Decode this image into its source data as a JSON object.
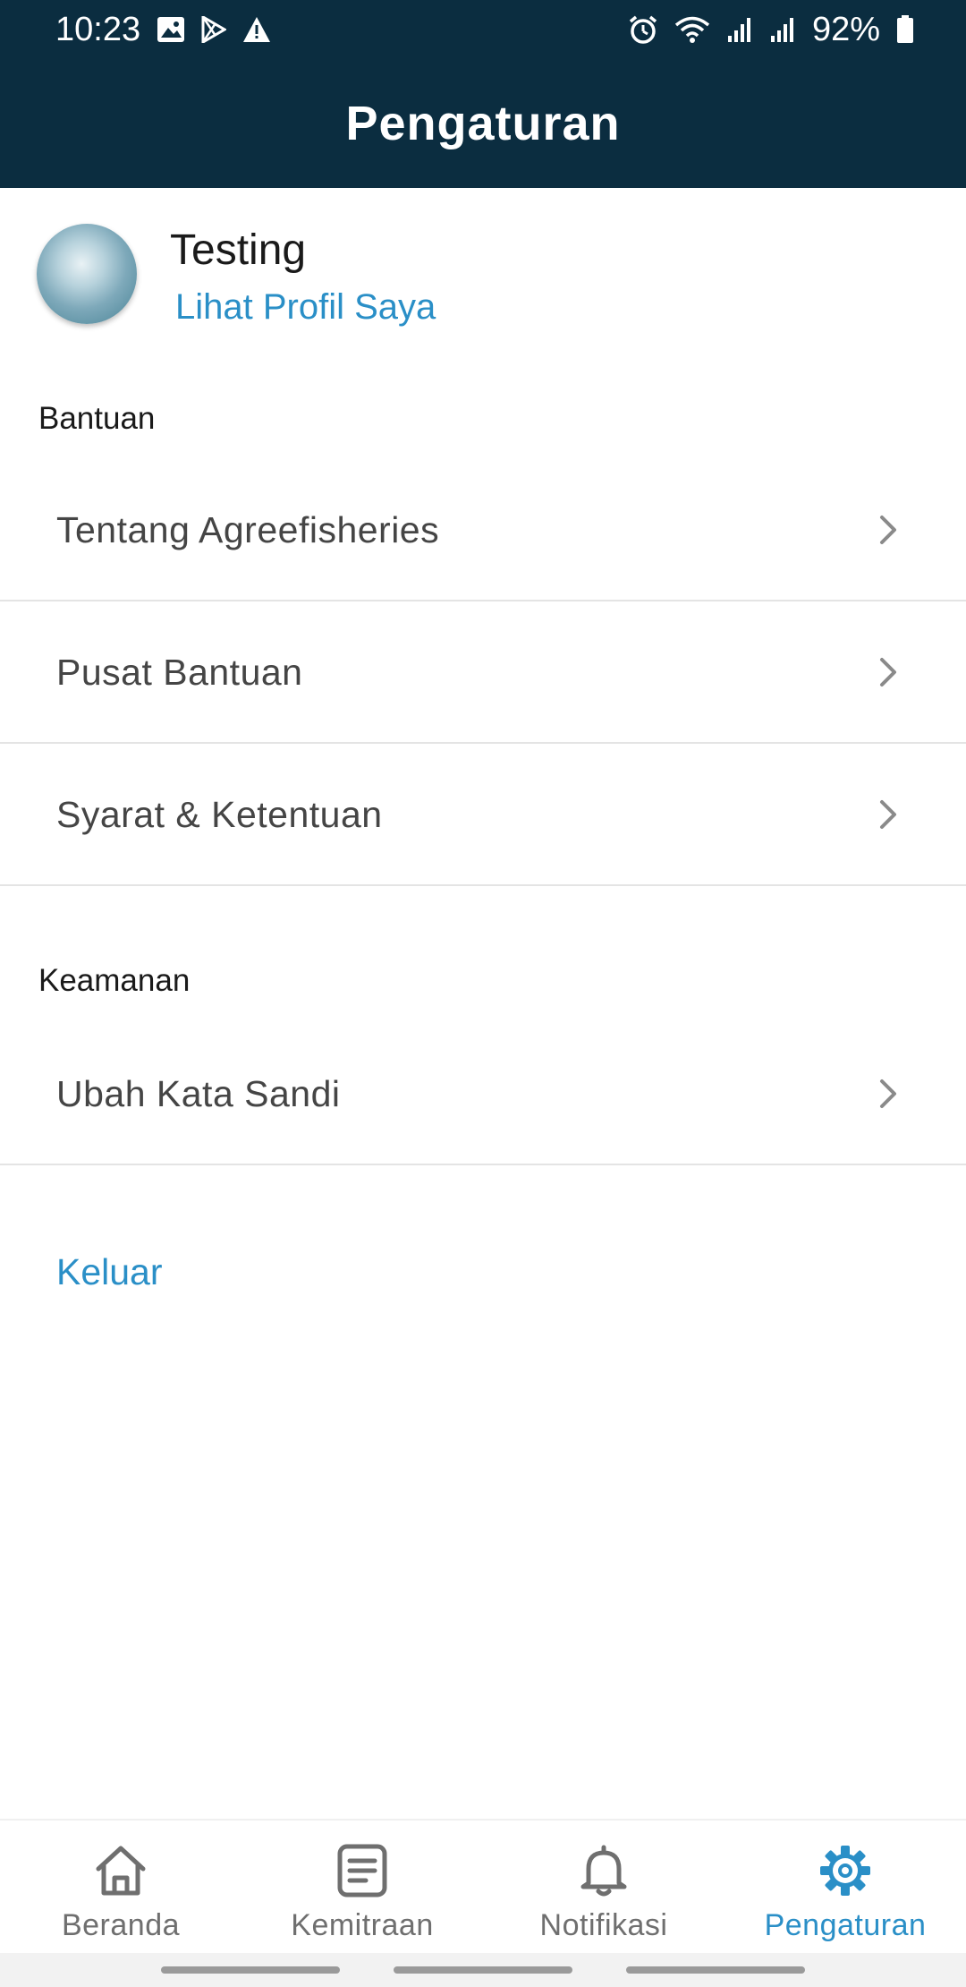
{
  "status_bar": {
    "time": "10:23",
    "battery": "92%",
    "left_icons": [
      "image-icon",
      "play-store-icon",
      "warning-icon"
    ],
    "right_icons": [
      "alarm-icon",
      "wifi-icon",
      "signal-icon",
      "signal-icon",
      "battery-icon"
    ]
  },
  "header": {
    "title": "Pengaturan"
  },
  "profile": {
    "name": "Testing",
    "link": "Lihat Profil Saya"
  },
  "sections": {
    "help": {
      "title": "Bantuan",
      "items": [
        {
          "label": "Tentang Agreefisheries"
        },
        {
          "label": "Pusat Bantuan"
        },
        {
          "label": "Syarat & Ketentuan"
        }
      ]
    },
    "security": {
      "title": "Keamanan",
      "items": [
        {
          "label": "Ubah Kata Sandi"
        }
      ]
    }
  },
  "logout": {
    "label": "Keluar"
  },
  "bottom_nav": {
    "items": [
      {
        "label": "Beranda",
        "icon": "home-icon",
        "active": false
      },
      {
        "label": "Kemitraan",
        "icon": "document-icon",
        "active": false
      },
      {
        "label": "Notifikasi",
        "icon": "bell-icon",
        "active": false
      },
      {
        "label": "Pengaturan",
        "icon": "gear-icon",
        "active": true
      }
    ]
  },
  "colors": {
    "header_bg": "#0b2d40",
    "accent": "#2a8fc7",
    "text_muted": "#6f6f6f"
  }
}
